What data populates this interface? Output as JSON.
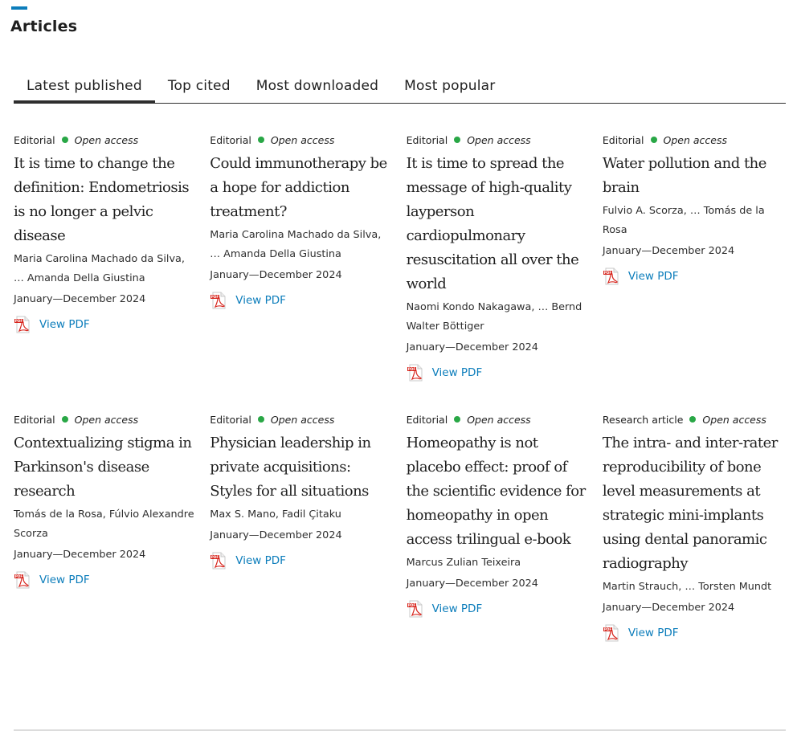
{
  "section": {
    "title": "Articles"
  },
  "colors": {
    "accent": "#0c7dbb",
    "open_access_dot": "#29a746",
    "link": "#0c7dbb"
  },
  "tabs": [
    {
      "label": "Latest published",
      "active": true
    },
    {
      "label": "Top cited",
      "active": false
    },
    {
      "label": "Most downloaded",
      "active": false
    },
    {
      "label": "Most popular",
      "active": false
    }
  ],
  "articles": [
    {
      "type": "Editorial",
      "access": "Open access",
      "title": "It is time to change the definition: Endometriosis is no longer a pelvic disease",
      "authors": "Maria Carolina Machado da Silva, … Amanda Della Giustina",
      "date": "January—December 2024",
      "pdf_label": "View PDF",
      "icon": "pdf-icon"
    },
    {
      "type": "Editorial",
      "access": "Open access",
      "title": "Could immunotherapy be a hope for addiction treatment?",
      "authors": "Maria Carolina Machado da Silva, … Amanda Della Giustina",
      "date": "January—December 2024",
      "pdf_label": "View PDF",
      "icon": "pdf-icon"
    },
    {
      "type": "Editorial",
      "access": "Open access",
      "title": "It is time to spread the message of high-quality layperson cardiopulmonary resuscitation all over the world",
      "authors": "Naomi Kondo Nakagawa, … Bernd Walter Böttiger",
      "date": "January—December 2024",
      "pdf_label": "View PDF",
      "icon": "pdf-icon"
    },
    {
      "type": "Editorial",
      "access": "Open access",
      "title": "Water pollution and the brain",
      "authors": "Fulvio A. Scorza, … Tomás de la Rosa",
      "date": "January—December 2024",
      "pdf_label": "View PDF",
      "icon": "pdf-icon"
    },
    {
      "type": "Editorial",
      "access": "Open access",
      "title": "Contextualizing stigma in Parkinson's disease research",
      "authors": "Tomás de la Rosa, Fúlvio Alexandre Scorza",
      "date": "January—December 2024",
      "pdf_label": "View PDF",
      "icon": "pdf-icon"
    },
    {
      "type": "Editorial",
      "access": "Open access",
      "title": "Physician leadership in private acquisitions: Styles for all situations",
      "authors": "Max S. Mano, Fadil Çitaku",
      "date": "January—December 2024",
      "pdf_label": "View PDF",
      "icon": "pdf-icon"
    },
    {
      "type": "Editorial",
      "access": "Open access",
      "title": "Homeopathy is not placebo effect: proof of the scientific evidence for homeopathy in open access trilingual e-book",
      "authors": "Marcus Zulian Teixeira",
      "date": "January—December 2024",
      "pdf_label": "View PDF",
      "icon": "pdf-icon"
    },
    {
      "type": "Research article",
      "access": "Open access",
      "title": "The intra- and inter-rater reproducibility of bone level measurements at strategic mini-implants using dental panoramic radiography",
      "authors": "Martin Strauch, … Torsten Mundt",
      "date": "January—December 2024",
      "pdf_label": "View PDF",
      "icon": "pdf-icon"
    }
  ]
}
